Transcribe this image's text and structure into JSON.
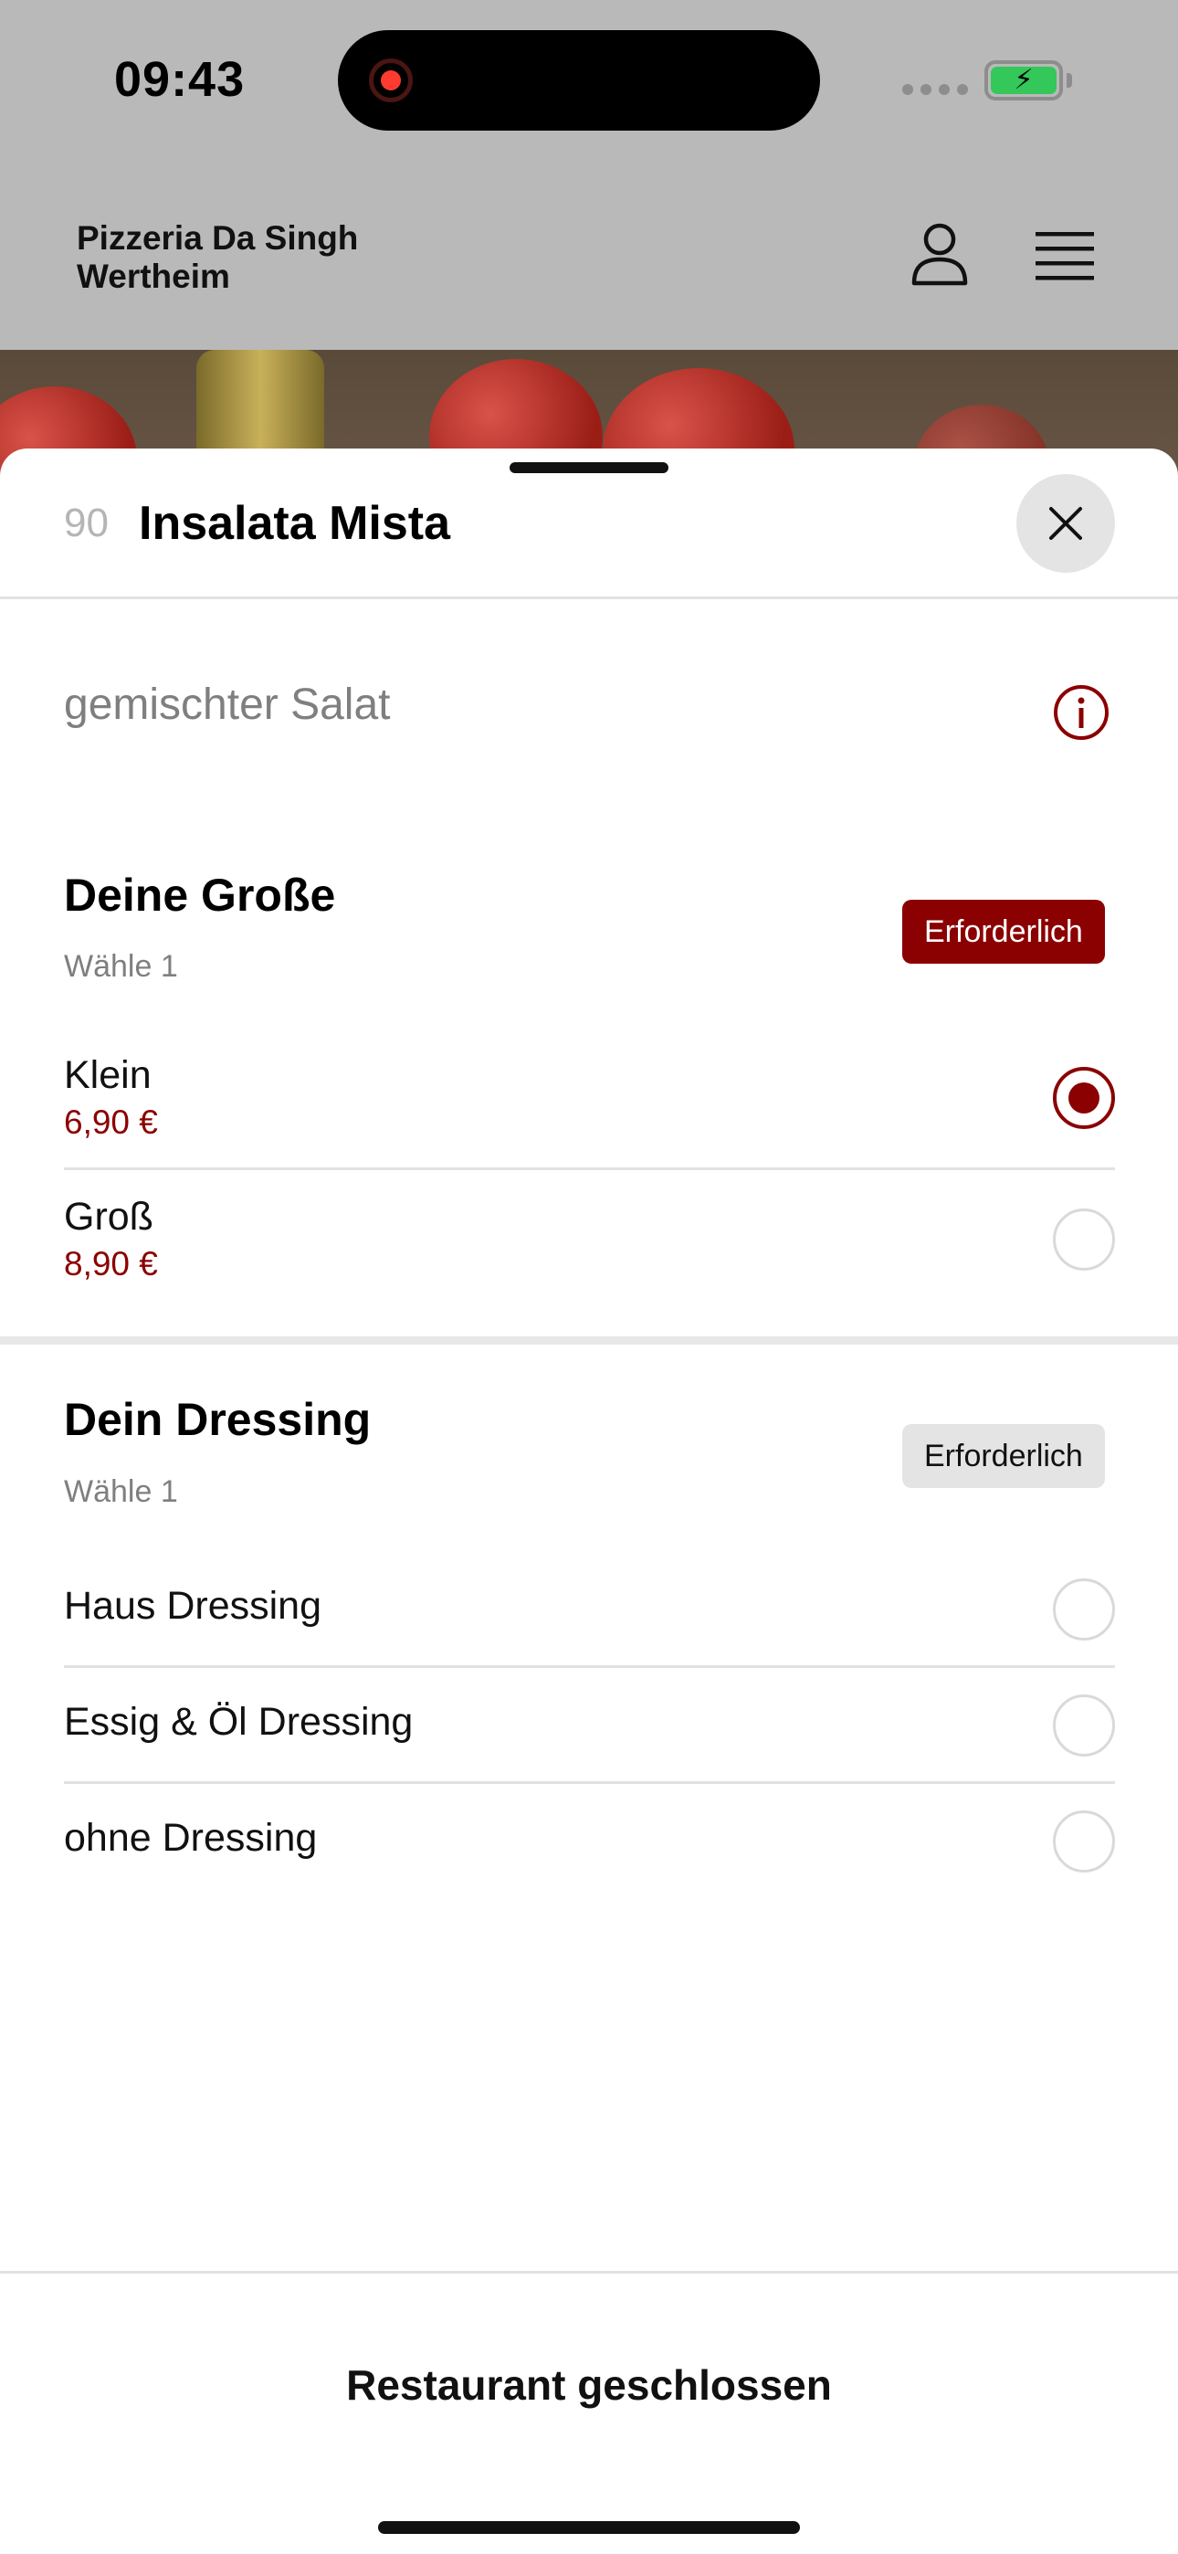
{
  "statusbar": {
    "time": "09:43"
  },
  "header": {
    "title_line1": "Pizzeria Da Singh",
    "title_line2": "Wertheim",
    "user_icon": "user-icon",
    "menu_icon": "hamburger-menu-icon"
  },
  "item": {
    "number": "90",
    "title": "Insalata Mista",
    "description": "gemischter Salat"
  },
  "groups": [
    {
      "title": "Deine Große",
      "subtitle": "Wähle 1",
      "badge": "Erforderlich",
      "options": [
        {
          "name": "Klein",
          "price": "6,90 €",
          "selected": true
        },
        {
          "name": "Groß",
          "price": "8,90 €",
          "selected": false
        }
      ]
    },
    {
      "title": "Dein Dressing",
      "subtitle": "Wähle 1",
      "badge": "Erforderlich",
      "options": [
        {
          "name": "Haus Dressing",
          "selected": false
        },
        {
          "name": "Essig & Öl Dressing",
          "selected": false
        },
        {
          "name": "ohne Dressing",
          "selected": false
        }
      ]
    }
  ],
  "footer": {
    "label": "Restaurant geschlossen"
  },
  "colors": {
    "accent": "#8b0000",
    "badge_grey": "#e4e4e4"
  }
}
